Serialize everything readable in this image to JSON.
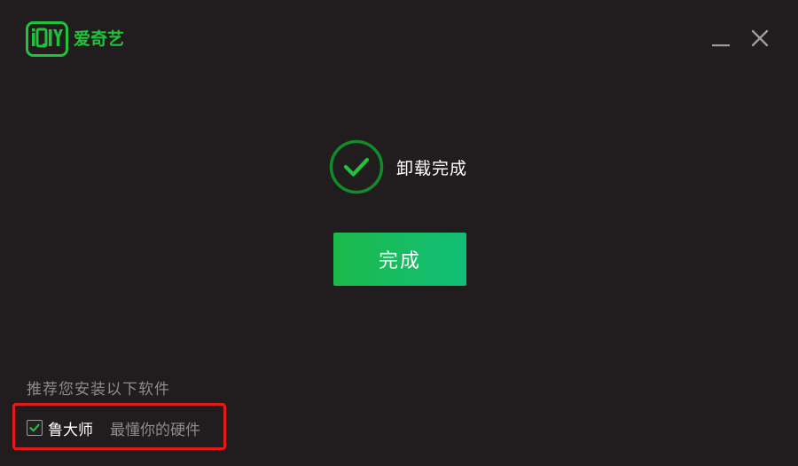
{
  "app": {
    "logo_brand": "iQIYI",
    "logo_text": "爱奇艺",
    "brand_color": "#22c13a"
  },
  "window_controls": {
    "minimize_icon": "minimize-icon",
    "close_icon": "close-icon"
  },
  "status": {
    "icon": "check-circle-icon",
    "text": "卸载完成"
  },
  "actions": {
    "done_label": "完成",
    "done_color": "#16bd66"
  },
  "recommend": {
    "title": "推荐您安装以下软件",
    "highlight_color": "#e3191a",
    "items": [
      {
        "checked": true,
        "name": "鲁大师",
        "description": "最懂你的硬件"
      }
    ]
  }
}
